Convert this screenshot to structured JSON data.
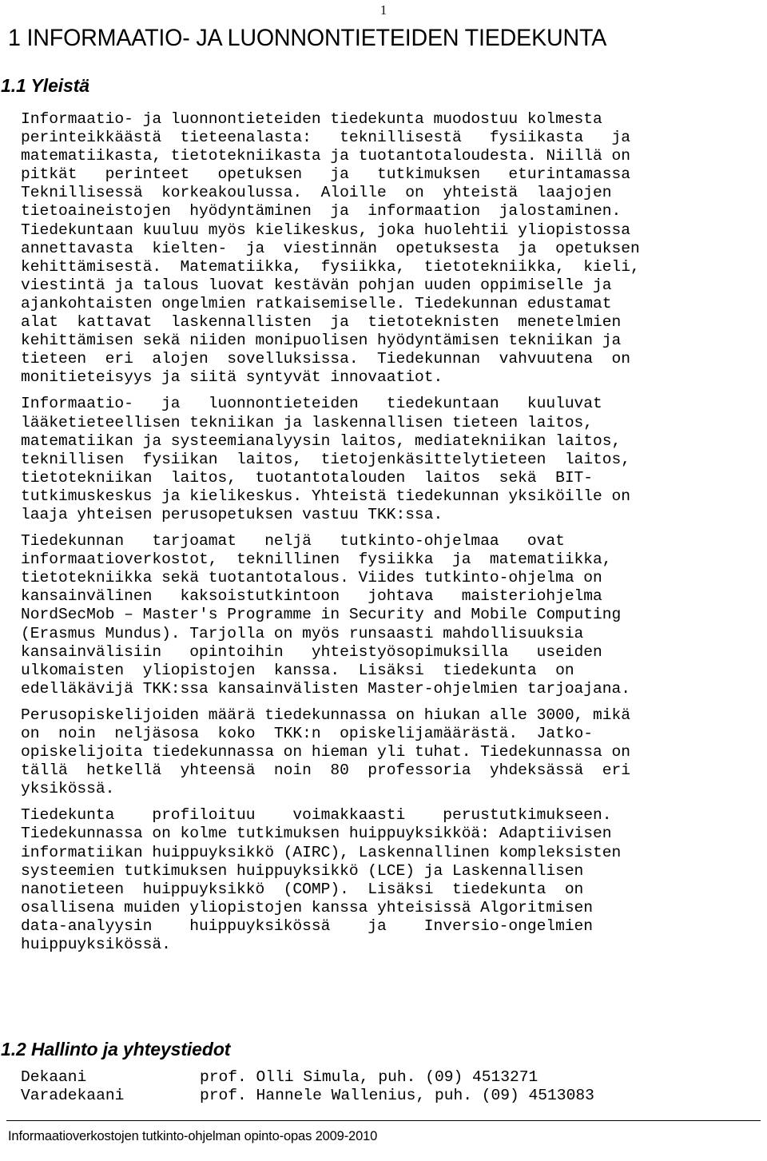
{
  "document": {
    "page_number": "1",
    "title": "1 INFORMAATIO- JA LUONNONTIETEIDEN TIEDEKUNTA"
  },
  "sections": {
    "yleista": {
      "heading": "1.1 Yleistä",
      "paragraphs": [
        "Informaatio- ja luonnontieteiden tiedekunta muodostuu kolmesta perinteikkäästä tieteenalasta: teknillisestä fysiikasta ja matematiikasta, tietotekniikasta ja tuotantotaloudesta. Niillä on pitkät perinteet opetuksen ja tutkimuksen eturintamassa Teknillisessä korkeakoulussa. Aloille on yhteistä laajojen tietoaineistojen hyödyntäminen ja informaation jalostaminen. Tiedekuntaan kuuluu myös kielikeskus, joka huolehtii yliopistossa annettavasta kielten- ja viestinnän opetuksesta ja opetuksen kehittämisestä. Matematiikka, fysiikka, tietotekniikka, kieli, viestintä ja talous luovat kestävän pohjan uuden oppimiselle ja ajankohtaisten ongelmien ratkaisemiselle. Tiedekunnan edustamat alat kattavat laskennallisten ja tietoteknisten menetelmien kehittämisen sekä niiden monipuolisen hyödyntämisen tekniikan ja tieteen eri alojen sovelluksissa. Tiedekunnan vahvuutena on monitieteisyys ja siitä syntyvät innovaatiot.",
        "Informaatio- ja luonnontieteiden tiedekuntaan kuuluvat lääketieteellisen tekniikan ja laskennallisen tieteen laitos, matematiikan ja systeemianalyysin laitos, mediatekniikan laitos, teknillisen fysiikan laitos, tietojenkäsittelytieteen laitos, tietotekniikan laitos, tuotantotalouden laitos sekä BIT-tutkimuskeskus ja kielikeskus. Yhteistä tiedekunnan yksiköille on laaja yhteisen perusopetuksen vastuu TKK:ssa.",
        "Tiedekunnan tarjoamat neljä tutkinto-ohjelmaa ovat informaatioverkostot, teknillinen fysiikka ja matematiikka, tietotekniikka sekä tuotantotalous. Viides tutkinto-ohjelma on kansainvälinen kaksoistutkintoon johtava maisteriohjelma NordSecMob – Master's Programme in Security and Mobile Computing (Erasmus Mundus). Tarjolla on myös runsaasti mahdollisuuksia kansainvälisiin opintoihin yhteistyösopimuksilla useiden ulkomaisten yliopistojen kanssa. Lisäksi tiedekunta on edelläkävijä TKK:ssa kansainvälisten Master-ohjelmien tarjoajana.",
        "Perusopiskelijoiden määrä tiedekunnassa on hiukan alle 3000, mikä on noin neljäsosa koko TKK:n opiskelijamäärästä. Jatko-opiskelijoita tiedekunnassa on hieman yli tuhat. Tiedekunnassa on tällä hetkellä yhteensä noin 80 professoria yhdeksässä eri yksikössä.",
        "Tiedekunta profiloituu voimakkaasti perustutkimukseen. Tiedekunnassa on kolme tutkimuksen huippuyksikköä: Adaptiivisen informatiikan huippuyksikkö (AIRC), Laskennallinen kompleksisten systeemien tutkimuksen huippuyksikkö (LCE) ja Laskennallisen nanotieteen huippuyksikkö (COMP). Lisäksi tiedekunta on osallisena muiden yliopistojen kanssa yhteisissä Algoritmisen data-analyysin huippuyksikössä ja Inversio-ongelmien huippuyksikössä."
      ],
      "paragraph_lines": [
        [
          "Informaatio- ja luonnontieteiden tiedekunta muodostuu kolmesta",
          "perinteikkäästä  tieteenalasta:   teknillisestä   fysiikasta   ja",
          "matematiikasta, tietotekniikasta ja tuotantotaloudesta. Niillä on",
          "pitkät   perinteet   opetuksen   ja   tutkimuksen   eturintamassa",
          "Teknillisessä  korkeakoulussa.  Aloille  on  yhteistä  laajojen",
          "tietoaineistojen  hyödyntäminen  ja  informaation  jalostaminen.",
          "Tiedekuntaan kuuluu myös kielikeskus, joka huolehtii yliopistossa",
          "annettavasta  kielten-  ja  viestinnän  opetuksesta  ja  opetuksen",
          "kehittämisestä.  Matematiikka,  fysiikka,  tietotekniikka,  kieli,",
          "viestintä ja talous luovat kestävän pohjan uuden oppimiselle ja",
          "ajankohtaisten ongelmien ratkaisemiselle. Tiedekunnan edustamat",
          "alat  kattavat  laskennallisten  ja  tietoteknisten  menetelmien",
          "kehittämisen sekä niiden monipuolisen hyödyntämisen tekniikan ja",
          "tieteen  eri  alojen  sovelluksissa.  Tiedekunnan  vahvuutena  on",
          "monitieteisyys ja siitä syntyvät innovaatiot."
        ],
        [
          "Informaatio-   ja   luonnontieteiden   tiedekuntaan   kuuluvat",
          "lääketieteellisen tekniikan ja laskennallisen tieteen laitos,",
          "matematiikan ja systeemianalyysin laitos, mediatekniikan laitos,",
          "teknillisen  fysiikan  laitos,  tietojenkäsittelytieteen  laitos,",
          "tietotekniikan  laitos,  tuotantotalouden  laitos  sekä  BIT-",
          "tutkimuskeskus ja kielikeskus. Yhteistä tiedekunnan yksiköille on",
          "laaja yhteisen perusopetuksen vastuu TKK:ssa."
        ],
        [
          "Tiedekunnan   tarjoamat   neljä   tutkinto-ohjelmaa   ovat",
          "informaatioverkostot,  teknillinen  fysiikka  ja  matematiikka,",
          "tietotekniikka sekä tuotantotalous. Viides tutkinto-ohjelma on",
          "kansainvälinen   kaksoistutkintoon   johtava   maisteriohjelma",
          "NordSecMob – Master's Programme in Security and Mobile Computing",
          "(Erasmus Mundus). Tarjolla on myös runsaasti mahdollisuuksia",
          "kansainvälisiin   opintoihin   yhteistyösopimuksilla   useiden",
          "ulkomaisten  yliopistojen  kanssa.  Lisäksi  tiedekunta  on",
          "edelläkävijä TKK:ssa kansainvälisten Master-ohjelmien tarjoajana."
        ],
        [
          "Perusopiskelijoiden määrä tiedekunnassa on hiukan alle 3000, mikä",
          "on  noin  neljäsosa  koko  TKK:n  opiskelijamäärästä.  Jatko-",
          "opiskelijoita tiedekunnassa on hieman yli tuhat. Tiedekunnassa on",
          "tällä  hetkellä  yhteensä  noin  80  professoria  yhdeksässä  eri",
          "yksikössä."
        ],
        [
          "Tiedekunta    profiloituu    voimakkaasti    perustutkimukseen.",
          "Tiedekunnassa on kolme tutkimuksen huippuyksikköä: Adaptiivisen",
          "informatiikan huippuyksikkö (AIRC), Laskennallinen kompleksisten",
          "systeemien tutkimuksen huippuyksikkö (LCE) ja Laskennallisen",
          "nanotieteen  huippuyksikkö  (COMP).  Lisäksi  tiedekunta  on",
          "osallisena muiden yliopistojen kanssa yhteisissä Algoritmisen",
          "data-analyysin    huippuyksikössä    ja    Inversio-ongelmien",
          "huippuyksikössä."
        ]
      ]
    },
    "hallinto": {
      "heading": "1.2 Hallinto ja yhteystiedot",
      "contacts": [
        {
          "role": "Dekaani",
          "value": "prof. Olli Simula, puh. (09) 4513271"
        },
        {
          "role": "Varadekaani",
          "value": "prof. Hannele Wallenius, puh. (09) 4513083"
        }
      ]
    }
  },
  "footer": {
    "text": "Informaatioverkostojen tutkinto-ohjelman opinto-opas 2009-2010"
  },
  "colors": {
    "text": "#000000",
    "background": "#ffffff",
    "rule": "#000000"
  }
}
